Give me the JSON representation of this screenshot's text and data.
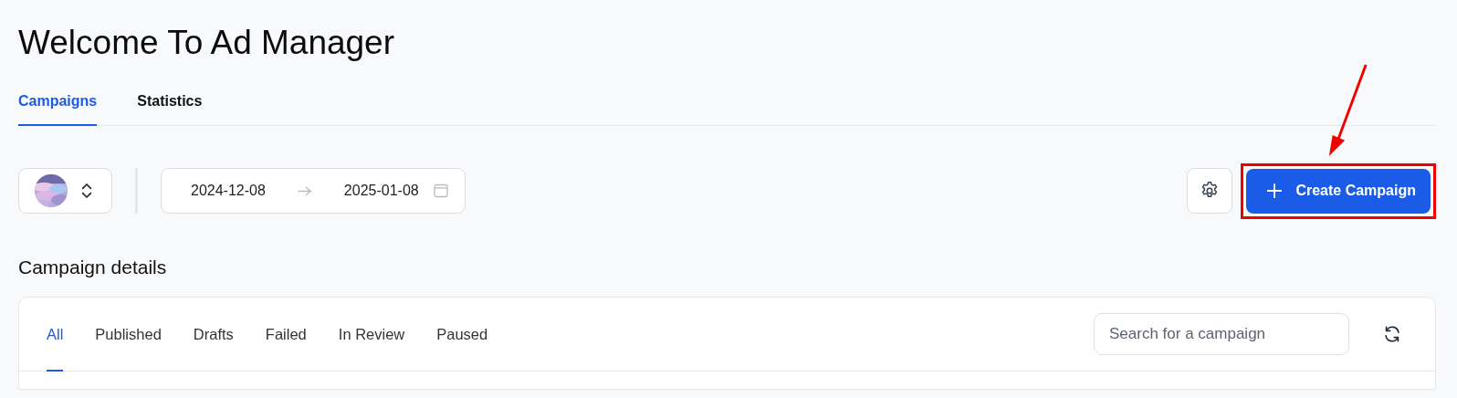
{
  "page": {
    "title": "Welcome To Ad Manager"
  },
  "tabs": [
    {
      "label": "Campaigns",
      "selected": true
    },
    {
      "label": "Statistics",
      "selected": false
    }
  ],
  "toolbar": {
    "date_range": {
      "start": "2024-12-08",
      "end": "2025-01-08"
    },
    "create_button": {
      "label": "Create Campaign",
      "highlighted": true
    }
  },
  "section": {
    "title": "Campaign details"
  },
  "filters": [
    {
      "label": "All",
      "selected": true
    },
    {
      "label": "Published",
      "selected": false
    },
    {
      "label": "Drafts",
      "selected": false
    },
    {
      "label": "Failed",
      "selected": false
    },
    {
      "label": "In Review",
      "selected": false
    },
    {
      "label": "Paused",
      "selected": false
    }
  ],
  "search": {
    "placeholder": "Search for a campaign"
  }
}
